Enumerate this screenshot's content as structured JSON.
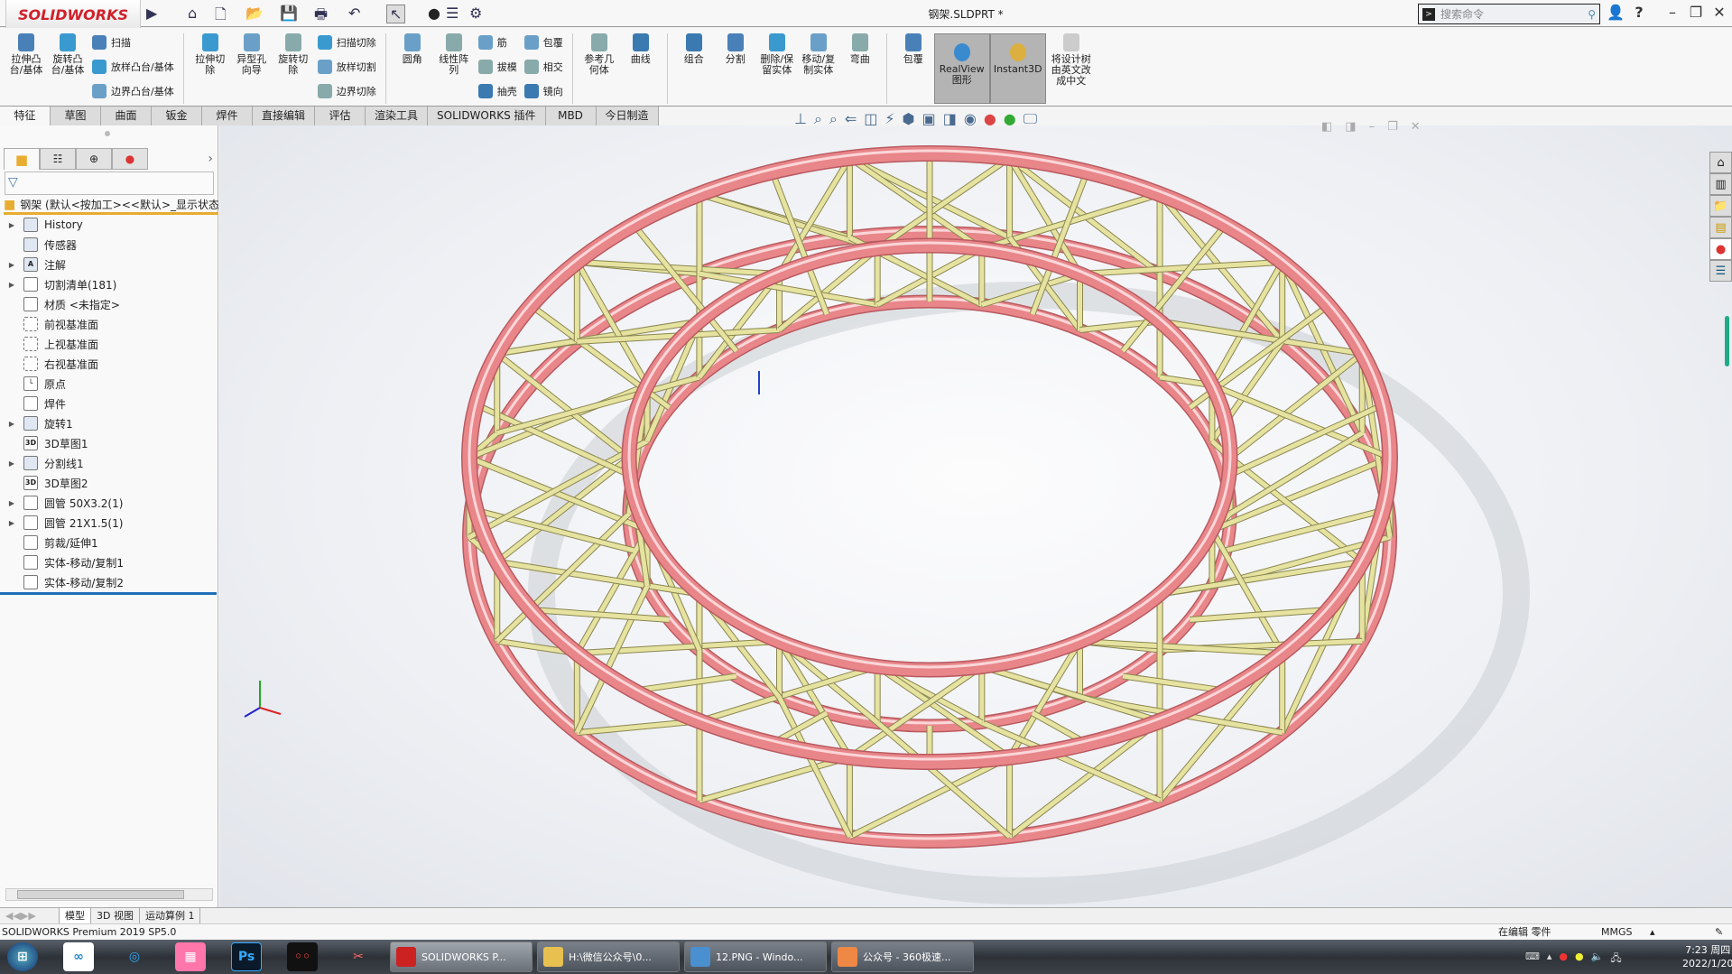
{
  "app": {
    "brand": "SOLIDWORKS",
    "doc_title": "钢架.SLDPRT *",
    "search_placeholder": "搜索命令"
  },
  "quick_access": [
    "home-icon",
    "new-icon",
    "open-icon",
    "save-icon",
    "print-icon",
    "undo-icon",
    "select-icon",
    "rebuild-icon",
    "file-properties-icon",
    "options-icon"
  ],
  "cmd_groups": [
    {
      "big": [
        "拉伸凸\n台/基体",
        "旋转凸\n台/基体"
      ],
      "small": [
        "扫描",
        "放样凸台/基体",
        "边界凸台/基体"
      ]
    },
    {
      "big": [
        "拉伸切\n除",
        "异型孔\n向导",
        "旋转切\n除"
      ],
      "small": [
        "扫描切除",
        "放样切割",
        "边界切除"
      ]
    },
    {
      "big": [
        "圆角",
        "线性阵\n列"
      ],
      "small": [
        "筋",
        "拔模",
        "抽壳"
      ],
      "small2": [
        "包覆",
        "相交",
        "镜向"
      ]
    },
    {
      "big": [
        "参考几\n何体",
        "曲线"
      ]
    },
    {
      "big": [
        "组合",
        "分割",
        "删除/保\n留实体",
        "移动/复\n制实体",
        "弯曲"
      ]
    },
    {
      "big": [
        "包覆"
      ],
      "toggles": [
        "RealView\n图形",
        "Instant3D"
      ],
      "last": [
        "将设计树\n由英文改\n成中文"
      ]
    }
  ],
  "tabs": [
    "特征",
    "草图",
    "曲面",
    "钣金",
    "焊件",
    "直接编辑",
    "评估",
    "渲染工具",
    "SOLIDWORKS 插件",
    "MBD",
    "今日制造"
  ],
  "active_tab": "特征",
  "tree": {
    "root": "钢架  (默认<按加工><<默认>_显示状态",
    "items": [
      {
        "label": "History",
        "icon": "history-folder-icon",
        "expand": true
      },
      {
        "label": "传感器",
        "icon": "sensor-folder-icon",
        "expand": false
      },
      {
        "label": "注解",
        "icon": "annotation-folder-icon",
        "expand": true
      },
      {
        "label": "切割清单(181)",
        "icon": "cut-list-icon",
        "expand": true
      },
      {
        "label": "材质 <未指定>",
        "icon": "material-icon",
        "expand": false
      },
      {
        "label": "前视基准面",
        "icon": "plane-icon",
        "expand": false
      },
      {
        "label": "上视基准面",
        "icon": "plane-icon",
        "expand": false
      },
      {
        "label": "右视基准面",
        "icon": "plane-icon",
        "expand": false
      },
      {
        "label": "原点",
        "icon": "origin-icon",
        "expand": false
      },
      {
        "label": "焊件",
        "icon": "weldment-icon",
        "expand": false
      },
      {
        "label": "旋转1",
        "icon": "revolve-icon",
        "expand": true
      },
      {
        "label": "3D草图1",
        "icon": "3d-sketch-icon",
        "expand": false
      },
      {
        "label": "分割线1",
        "icon": "split-line-icon",
        "expand": true
      },
      {
        "label": "3D草图2",
        "icon": "3d-sketch-icon",
        "expand": false
      },
      {
        "label": "圆管 50X3.2(1)",
        "icon": "structural-member-icon",
        "expand": true
      },
      {
        "label": "圆管 21X1.5(1)",
        "icon": "structural-member-icon",
        "expand": true
      },
      {
        "label": "剪裁/延伸1",
        "icon": "trim-extend-icon",
        "expand": false
      },
      {
        "label": "实体-移动/复制1",
        "icon": "move-copy-body-icon",
        "expand": false
      },
      {
        "label": "实体-移动/复制2",
        "icon": "move-copy-body-icon",
        "expand": false
      }
    ]
  },
  "bottom_tabs": [
    "模型",
    "3D 视图",
    "运动算例 1"
  ],
  "status": {
    "left": "SOLIDWORKS Premium 2019 SP5.0",
    "editing": "在编辑 零件",
    "units": "MMGS"
  },
  "taskbar": {
    "apps": [
      {
        "label": "SOLIDWORKS P..."
      },
      {
        "label": "H:\\微信公众号\\0..."
      },
      {
        "label": "12.PNG - Windo..."
      },
      {
        "label": "公众号 - 360极速..."
      }
    ],
    "time": "7:23 周四",
    "date": "2022/1/20"
  },
  "colors": {
    "tube_main": "#e8868a",
    "tube_strut": "#e6e2a0",
    "brand": "#d0202a",
    "accent": "#1f6fb8"
  }
}
